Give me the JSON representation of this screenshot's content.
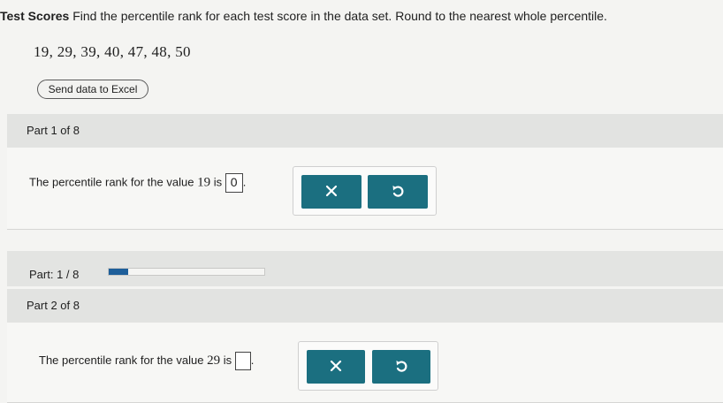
{
  "problem": {
    "heading": "Test Scores",
    "instruction": "Find the percentile rank for each test score in the data set. Round to the nearest whole percentile.",
    "data_values": "19, 29, 39, 40, 47, 48, 50"
  },
  "excel_button": {
    "label": "Send data to Excel"
  },
  "part1": {
    "header": "Part 1 of 8",
    "prefix": "The percentile rank for the value",
    "value": "19",
    "is": "is",
    "answer": "0",
    "suffix": "."
  },
  "part2": {
    "header": "Part 2 of 8",
    "prefix": "The percentile rank for the value",
    "value": "29",
    "is": "is",
    "answer": "",
    "suffix": "."
  },
  "progress": {
    "label": "Part: 1 / 8",
    "fraction": 0.125
  },
  "icons": {
    "clear": "x-icon",
    "undo": "undo-icon"
  },
  "colors": {
    "button": "#1b6f80",
    "progress_fill": "#1e5f9a",
    "header_band": "#e2e3e1"
  }
}
